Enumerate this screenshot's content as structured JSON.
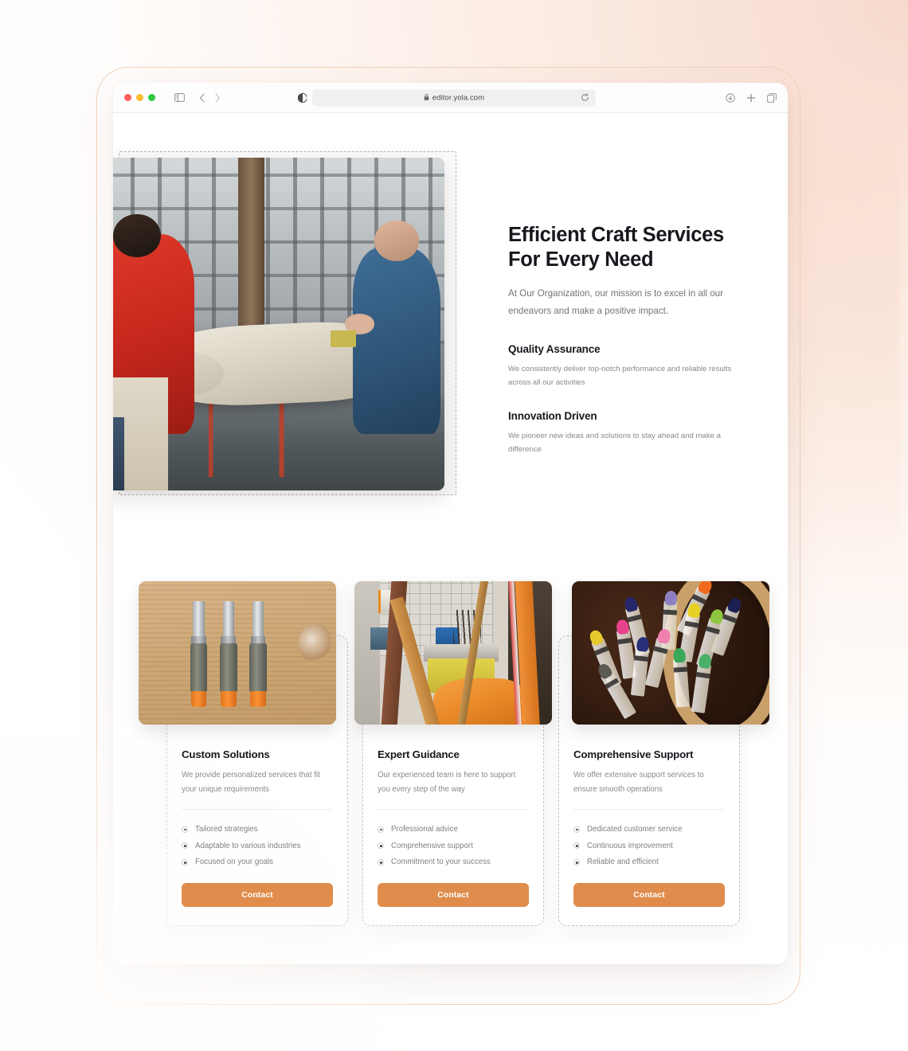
{
  "browser": {
    "url": "editor.yola.com",
    "lock_icon": "lock-icon",
    "traffic_lights": [
      "close-red",
      "minimize-yellow",
      "maximize-green"
    ],
    "icons": {
      "sidebar": "sidebar-toggle-icon",
      "back": "back-chevron-icon",
      "forward": "forward-chevron-icon",
      "reader": "reader-mode-icon",
      "reload": "reload-icon",
      "download": "downloads-icon",
      "new_tab": "new-tab-plus-icon",
      "tab_overview": "tab-overview-icon"
    }
  },
  "hero": {
    "title": "Efficient Craft Services For Every Need",
    "subtitle": "At Our Organization, our mission is to excel in all our endeavors and make a positive impact.",
    "image_alt": "two-restorers-working-on-stone-statue",
    "features": [
      {
        "heading": "Quality Assurance",
        "text": "We consistently deliver top-notch performance and reliable results across all our activities"
      },
      {
        "heading": "Innovation Driven",
        "text": "We pioneer new ideas and solutions to stay ahead and make a difference"
      }
    ]
  },
  "cards": [
    {
      "title": "Custom Solutions",
      "description": "We provide personalized services that fit your unique requirements",
      "image_alt": "three-wood-chisels-on-board",
      "bullets": [
        "Tailored strategies",
        "Adaptable to various industries",
        "Focused on your goals"
      ],
      "button_label": "Contact"
    },
    {
      "title": "Expert Guidance",
      "description": "Our experienced team is here to support you every step of the way",
      "image_alt": "cluttered-art-studio-with-orange-cloth",
      "bullets": [
        "Professional advice",
        "Comprehensive support",
        "Commitment to your success"
      ],
      "button_label": "Contact"
    },
    {
      "title": "Comprehensive Support",
      "description": "We offer extensive support services to ensure smooth operations",
      "image_alt": "colored-crayons-in-wooden-bowl",
      "bullets": [
        "Dedicated customer service",
        "Continuous improvement",
        "Reliable and efficient"
      ],
      "button_label": "Contact"
    }
  ],
  "colors": {
    "accent_button": "#df8c4c",
    "heading": "#16181d",
    "body_text": "#85898e",
    "selection_dash": "#c2c2c2",
    "page_gradient_from": "#f6d9cd",
    "page_gradient_to": "#ffffff",
    "frame_border": "#f0d2b8"
  }
}
